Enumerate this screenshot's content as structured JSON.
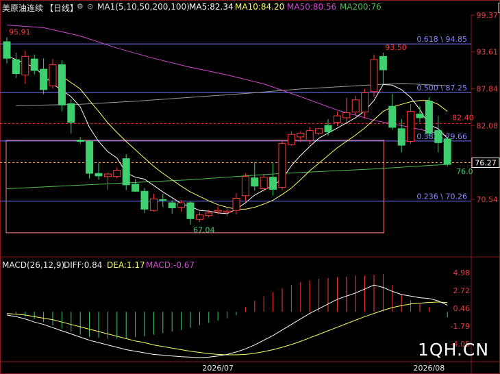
{
  "header": {
    "instrument": "美原油连续",
    "period": "【日线】",
    "ma_params": "MA1(5,10,50,200,100)",
    "ma5": "MA5:82.34",
    "ma10": "MA10:84.20",
    "ma50": "MA50:80.56",
    "ma200": "MA200:76",
    "icons": [
      "minus-icon",
      "plus-icon",
      "close-icon"
    ]
  },
  "macd_header": {
    "params": "MACD(26,12,9)",
    "diff": "DIFF:0.84",
    "dea": "DEA:1.17",
    "macd": "MACD:-0.67"
  },
  "watermark": "1QH.CN",
  "colors": {
    "up": "#ff3b3b",
    "down": "#3ecf6e",
    "ma5": "#ffffff",
    "ma10": "#ffff66",
    "ma50": "#d14ad1",
    "ma200": "#4fbf4f",
    "ma100": "#9a9a9a",
    "fib": "#7777ff",
    "macd_diff": "#ffffff",
    "macd_dea": "#ffff66"
  },
  "chart_data": {
    "type": "candlestick",
    "y_ticks": [
      "99.37",
      "93.61",
      "87.84",
      "82.08",
      "76.31",
      "70.54"
    ],
    "y_range": [
      64.0,
      99.37
    ],
    "x_labels": [
      {
        "index": 23,
        "label": "2026/07"
      },
      {
        "index": 46,
        "label": "2026/08"
      }
    ],
    "candles": [
      {
        "o": 95.2,
        "h": 95.9,
        "l": 91.8,
        "c": 92.6
      },
      {
        "o": 92.4,
        "h": 93.5,
        "l": 89.5,
        "c": 90.2
      },
      {
        "o": 90.0,
        "h": 93.8,
        "l": 88.6,
        "c": 92.9
      },
      {
        "o": 92.5,
        "h": 93.2,
        "l": 90.1,
        "c": 90.7
      },
      {
        "o": 90.9,
        "h": 92.6,
        "l": 87.0,
        "c": 87.7
      },
      {
        "o": 88.3,
        "h": 92.5,
        "l": 87.9,
        "c": 91.6
      },
      {
        "o": 91.6,
        "h": 92.3,
        "l": 84.3,
        "c": 85.3
      },
      {
        "o": 85.5,
        "h": 86.2,
        "l": 80.8,
        "c": 82.6
      },
      {
        "o": 79.8,
        "h": 80.3,
        "l": 79.2,
        "c": 79.6
      },
      {
        "o": 79.6,
        "h": 79.8,
        "l": 73.8,
        "c": 74.6
      },
      {
        "o": 74.6,
        "h": 76.2,
        "l": 73.6,
        "c": 74.2
      },
      {
        "o": 74.1,
        "h": 74.7,
        "l": 72.0,
        "c": 74.5
      },
      {
        "o": 74.1,
        "h": 75.5,
        "l": 73.8,
        "c": 75.1
      },
      {
        "o": 76.9,
        "h": 77.6,
        "l": 72.0,
        "c": 72.8
      },
      {
        "o": 72.9,
        "h": 73.7,
        "l": 71.7,
        "c": 71.8
      },
      {
        "o": 71.8,
        "h": 72.3,
        "l": 68.4,
        "c": 69.0
      },
      {
        "o": 68.8,
        "h": 71.4,
        "l": 68.6,
        "c": 70.6
      },
      {
        "o": 70.5,
        "h": 71.4,
        "l": 69.3,
        "c": 70.4
      },
      {
        "o": 70.0,
        "h": 70.4,
        "l": 68.3,
        "c": 69.2
      },
      {
        "o": 69.3,
        "h": 70.4,
        "l": 68.6,
        "c": 70.0
      },
      {
        "o": 70.0,
        "h": 70.2,
        "l": 66.6,
        "c": 67.5
      },
      {
        "o": 67.4,
        "h": 68.5,
        "l": 67.0,
        "c": 68.1
      },
      {
        "o": 68.0,
        "h": 68.9,
        "l": 67.7,
        "c": 68.4
      },
      {
        "o": 68.6,
        "h": 69.4,
        "l": 68.2,
        "c": 68.8
      },
      {
        "o": 68.5,
        "h": 69.1,
        "l": 67.9,
        "c": 68.7
      },
      {
        "o": 68.8,
        "h": 71.5,
        "l": 68.2,
        "c": 70.7
      },
      {
        "o": 71.1,
        "h": 74.6,
        "l": 70.2,
        "c": 74.1
      },
      {
        "o": 73.9,
        "h": 76.4,
        "l": 71.9,
        "c": 72.6
      },
      {
        "o": 72.2,
        "h": 74.5,
        "l": 71.7,
        "c": 74.0
      },
      {
        "o": 74.0,
        "h": 76.2,
        "l": 71.1,
        "c": 72.1
      },
      {
        "o": 72.4,
        "h": 79.8,
        "l": 72.0,
        "c": 79.3
      },
      {
        "o": 79.1,
        "h": 81.2,
        "l": 78.9,
        "c": 80.7
      },
      {
        "o": 80.3,
        "h": 81.2,
        "l": 79.5,
        "c": 80.9
      },
      {
        "o": 79.8,
        "h": 81.9,
        "l": 79.2,
        "c": 81.3
      },
      {
        "o": 80.9,
        "h": 81.7,
        "l": 80.6,
        "c": 81.6
      },
      {
        "o": 82.1,
        "h": 83.1,
        "l": 80.5,
        "c": 81.1
      },
      {
        "o": 82.6,
        "h": 84.3,
        "l": 82.0,
        "c": 83.6
      },
      {
        "o": 83.3,
        "h": 86.4,
        "l": 82.6,
        "c": 84.1
      },
      {
        "o": 84.2,
        "h": 86.7,
        "l": 83.7,
        "c": 86.1
      },
      {
        "o": 84.2,
        "h": 87.8,
        "l": 83.2,
        "c": 87.2
      },
      {
        "o": 87.4,
        "h": 93.2,
        "l": 86.6,
        "c": 92.4
      },
      {
        "o": 92.9,
        "h": 93.5,
        "l": 88.5,
        "c": 90.8
      },
      {
        "o": 85.1,
        "h": 87.0,
        "l": 81.4,
        "c": 81.8
      },
      {
        "o": 81.6,
        "h": 83.1,
        "l": 77.9,
        "c": 79.0
      },
      {
        "o": 79.6,
        "h": 85.4,
        "l": 79.2,
        "c": 84.3
      },
      {
        "o": 83.9,
        "h": 85.1,
        "l": 82.6,
        "c": 83.3
      },
      {
        "o": 85.9,
        "h": 86.5,
        "l": 80.4,
        "c": 80.9
      },
      {
        "o": 81.3,
        "h": 83.6,
        "l": 77.9,
        "c": 79.4
      },
      {
        "o": 80.0,
        "h": 80.3,
        "l": 75.7,
        "c": 76.0
      }
    ],
    "ma5": [
      {
        "i": 0,
        "v": 93.0
      },
      {
        "i": 3,
        "v": 91.2
      },
      {
        "i": 5,
        "v": 88.6
      },
      {
        "i": 7,
        "v": 86.6
      },
      {
        "i": 8,
        "v": 85.0
      },
      {
        "i": 9,
        "v": 81.8
      },
      {
        "i": 10,
        "v": 79.6
      },
      {
        "i": 11,
        "v": 78.0
      },
      {
        "i": 12,
        "v": 77.0
      },
      {
        "i": 13,
        "v": 74.7
      },
      {
        "i": 14,
        "v": 74.0
      },
      {
        "i": 15,
        "v": 73.7
      },
      {
        "i": 16,
        "v": 72.7
      },
      {
        "i": 17,
        "v": 71.7
      },
      {
        "i": 18,
        "v": 70.8
      },
      {
        "i": 19,
        "v": 69.9
      },
      {
        "i": 20,
        "v": 69.4
      },
      {
        "i": 21,
        "v": 68.8
      },
      {
        "i": 22,
        "v": 68.7
      },
      {
        "i": 23,
        "v": 68.4
      },
      {
        "i": 24,
        "v": 68.3
      },
      {
        "i": 25,
        "v": 69.0
      },
      {
        "i": 26,
        "v": 70.0
      },
      {
        "i": 27,
        "v": 71.2
      },
      {
        "i": 28,
        "v": 72.0
      },
      {
        "i": 29,
        "v": 72.7
      },
      {
        "i": 30,
        "v": 73.7
      },
      {
        "i": 31,
        "v": 75.8
      },
      {
        "i": 32,
        "v": 77.4
      },
      {
        "i": 33,
        "v": 78.8
      },
      {
        "i": 34,
        "v": 80.1
      },
      {
        "i": 35,
        "v": 80.9
      },
      {
        "i": 36,
        "v": 81.7
      },
      {
        "i": 37,
        "v": 82.5
      },
      {
        "i": 38,
        "v": 83.3
      },
      {
        "i": 39,
        "v": 84.4
      },
      {
        "i": 40,
        "v": 86.0
      },
      {
        "i": 41,
        "v": 88.5
      },
      {
        "i": 42,
        "v": 88.4
      },
      {
        "i": 43,
        "v": 87.7
      },
      {
        "i": 44,
        "v": 86.5
      },
      {
        "i": 45,
        "v": 84.6
      },
      {
        "i": 46,
        "v": 82.2
      },
      {
        "i": 47,
        "v": 81.6
      },
      {
        "i": 48,
        "v": 80.1
      }
    ],
    "ma10": [
      {
        "i": 6,
        "v": 89.8
      },
      {
        "i": 7,
        "v": 88.8
      },
      {
        "i": 8,
        "v": 87.8
      },
      {
        "i": 9,
        "v": 86.0
      },
      {
        "i": 10,
        "v": 84.3
      },
      {
        "i": 11,
        "v": 82.5
      },
      {
        "i": 12,
        "v": 81.0
      },
      {
        "i": 13,
        "v": 79.6
      },
      {
        "i": 14,
        "v": 78.3
      },
      {
        "i": 15,
        "v": 77.0
      },
      {
        "i": 16,
        "v": 75.7
      },
      {
        "i": 17,
        "v": 74.6
      },
      {
        "i": 18,
        "v": 73.6
      },
      {
        "i": 19,
        "v": 72.6
      },
      {
        "i": 20,
        "v": 71.7
      },
      {
        "i": 21,
        "v": 71.0
      },
      {
        "i": 22,
        "v": 70.3
      },
      {
        "i": 23,
        "v": 69.7
      },
      {
        "i": 24,
        "v": 69.3
      },
      {
        "i": 25,
        "v": 69.0
      },
      {
        "i": 26,
        "v": 69.0
      },
      {
        "i": 27,
        "v": 69.3
      },
      {
        "i": 28,
        "v": 69.8
      },
      {
        "i": 29,
        "v": 70.4
      },
      {
        "i": 30,
        "v": 71.3
      },
      {
        "i": 31,
        "v": 72.3
      },
      {
        "i": 32,
        "v": 73.6
      },
      {
        "i": 33,
        "v": 75.0
      },
      {
        "i": 34,
        "v": 76.2
      },
      {
        "i": 35,
        "v": 77.4
      },
      {
        "i": 36,
        "v": 78.6
      },
      {
        "i": 37,
        "v": 79.6
      },
      {
        "i": 38,
        "v": 80.6
      },
      {
        "i": 39,
        "v": 81.7
      },
      {
        "i": 40,
        "v": 83.0
      },
      {
        "i": 41,
        "v": 84.3
      },
      {
        "i": 42,
        "v": 85.0
      },
      {
        "i": 43,
        "v": 85.4
      },
      {
        "i": 44,
        "v": 85.8
      },
      {
        "i": 45,
        "v": 86.0
      },
      {
        "i": 46,
        "v": 86.0
      },
      {
        "i": 47,
        "v": 85.4
      },
      {
        "i": 48,
        "v": 84.3
      }
    ],
    "ma50": [
      {
        "i": 0,
        "v": 97.8
      },
      {
        "i": 4,
        "v": 97.4
      },
      {
        "i": 8,
        "v": 96.1
      },
      {
        "i": 12,
        "v": 94.2
      },
      {
        "i": 16,
        "v": 92.6
      },
      {
        "i": 20,
        "v": 91.2
      },
      {
        "i": 24,
        "v": 90.0
      },
      {
        "i": 28,
        "v": 88.6
      },
      {
        "i": 32,
        "v": 86.6
      },
      {
        "i": 36,
        "v": 84.5
      },
      {
        "i": 40,
        "v": 82.9
      },
      {
        "i": 44,
        "v": 81.8
      },
      {
        "i": 48,
        "v": 80.5
      }
    ],
    "ma100": [
      {
        "i": 1,
        "v": 85.2
      },
      {
        "i": 8,
        "v": 85.4
      },
      {
        "i": 14,
        "v": 85.9
      },
      {
        "i": 20,
        "v": 86.5
      },
      {
        "i": 26,
        "v": 87.1
      },
      {
        "i": 32,
        "v": 87.8
      },
      {
        "i": 38,
        "v": 88.3
      },
      {
        "i": 43,
        "v": 88.7
      },
      {
        "i": 48,
        "v": 88.3
      }
    ],
    "ma200": [
      {
        "i": 0,
        "v": 72.2
      },
      {
        "i": 10,
        "v": 72.9
      },
      {
        "i": 20,
        "v": 73.6
      },
      {
        "i": 30,
        "v": 74.6
      },
      {
        "i": 40,
        "v": 75.3
      },
      {
        "i": 48,
        "v": 76.0
      }
    ],
    "fib_levels": [
      {
        "label": "0.618 \\ 94.85",
        "value": 94.85
      },
      {
        "label": "0.500 \\ 87.25",
        "value": 87.25
      },
      {
        "label": "0.382 \\ 79.66",
        "value": 79.66
      },
      {
        "label": "0.236 \\ 70.26",
        "value": 70.26
      }
    ],
    "dashed_levels": [
      {
        "value": 82.4,
        "label": "82.40",
        "color": "#ff3b3b"
      },
      {
        "value": 76.27,
        "label": "76.27",
        "color": "#ffaa55"
      }
    ],
    "price_tag": {
      "value": 76.27,
      "label": "76.27"
    },
    "annotations": [
      {
        "i": 0,
        "value": 95.91,
        "label": "95.91",
        "color": "#ff3b3b",
        "pos": "above"
      },
      {
        "i": 41,
        "value": 93.5,
        "label": "93.50",
        "color": "#ff3b3b",
        "pos": "above"
      },
      {
        "i": 20,
        "value": 67.04,
        "label": "67.04",
        "color": "#3ecf6e",
        "pos": "below"
      },
      {
        "i": 48,
        "value": 76.0,
        "label": "76.0",
        "color": "#3ecf6e",
        "pos": "right"
      },
      {
        "i": 48,
        "value": 82.4,
        "label": "82.40",
        "color": "#ff3b3b",
        "pos": "tag"
      }
    ],
    "range_box": {
      "i0": 0,
      "i1": 41,
      "top": 79.8,
      "bottom": 65.3
    },
    "macd": {
      "y_ticks": [
        "4.98",
        "2.72",
        "0.46",
        "-1.79",
        "-4.05"
      ],
      "y_range": [
        -5.8,
        4.98
      ],
      "hist": [
        0.0,
        -0.3,
        -0.6,
        -0.9,
        -1.3,
        -1.7,
        -2.1,
        -2.5,
        -2.9,
        -3.2,
        -3.3,
        -3.4,
        -3.4,
        -3.3,
        -3.2,
        -3.1,
        -2.9,
        -2.7,
        -2.5,
        -2.3,
        -2.0,
        -1.7,
        -1.4,
        -1.1,
        -0.8,
        -0.4,
        0.6,
        1.4,
        2.0,
        2.5,
        3.0,
        3.4,
        3.8,
        4.0,
        4.2,
        4.3,
        4.4,
        4.5,
        4.6,
        4.6,
        4.7,
        4.8,
        3.4,
        2.2,
        1.5,
        1.0,
        0.6,
        0.0,
        -0.67
      ],
      "diff": [
        -0.4,
        -0.6,
        -0.9,
        -1.3,
        -1.6,
        -2.0,
        -2.4,
        -2.8,
        -3.2,
        -3.6,
        -3.9,
        -4.2,
        -4.5,
        -4.8,
        -5.0,
        -5.2,
        -5.4,
        -5.5,
        -5.6,
        -5.7,
        -5.75,
        -5.8,
        -5.75,
        -5.6,
        -5.4,
        -5.1,
        -4.7,
        -4.2,
        -3.6,
        -3.0,
        -2.3,
        -1.6,
        -0.9,
        -0.2,
        0.4,
        1.0,
        1.6,
        2.0,
        2.4,
        2.9,
        3.4,
        3.1,
        2.6,
        2.2,
        2.0,
        1.8,
        1.7,
        1.4,
        0.84
      ],
      "dea": [
        -0.2,
        -0.3,
        -0.4,
        -0.6,
        -0.8,
        -1.0,
        -1.3,
        -1.6,
        -1.9,
        -2.2,
        -2.5,
        -2.8,
        -3.1,
        -3.4,
        -3.7,
        -3.9,
        -4.2,
        -4.4,
        -4.6,
        -4.8,
        -5.0,
        -5.15,
        -5.3,
        -5.4,
        -5.45,
        -5.45,
        -5.4,
        -5.25,
        -5.05,
        -4.8,
        -4.5,
        -4.15,
        -3.75,
        -3.3,
        -2.85,
        -2.4,
        -1.95,
        -1.5,
        -1.05,
        -0.6,
        -0.2,
        0.2,
        0.55,
        0.8,
        1.0,
        1.1,
        1.2,
        1.25,
        1.17
      ]
    }
  }
}
